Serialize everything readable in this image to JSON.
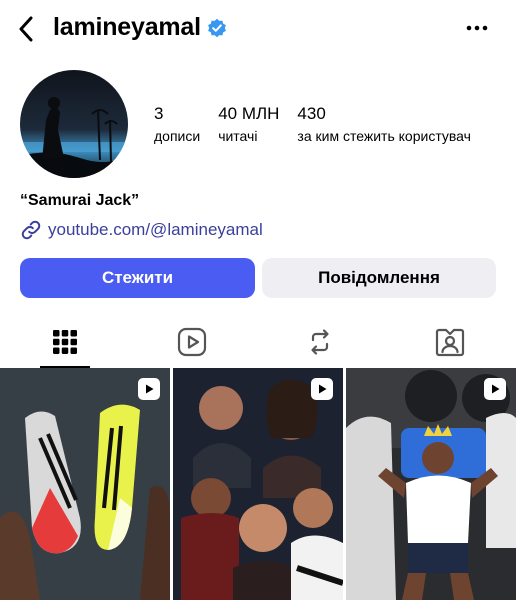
{
  "header": {
    "username": "lamineyamal"
  },
  "profile": {
    "stats": [
      {
        "value": "3",
        "label": "дописи"
      },
      {
        "value": "40 МЛН",
        "label": "читачі"
      },
      {
        "value": "430",
        "label": "за ким стежить користувач"
      }
    ],
    "bio": "“Samurai Jack”",
    "link": "youtube.com/@lamineyamal"
  },
  "actions": {
    "follow_label": "Стежити",
    "message_label": "Повідомлення"
  },
  "tabs": [
    "grid",
    "reels",
    "reposts",
    "tagged"
  ],
  "posts": [
    {
      "type": "reel",
      "icon": "reel-icon"
    },
    {
      "type": "reel",
      "icon": "reel-icon"
    },
    {
      "type": "reel",
      "icon": "reel-icon"
    }
  ],
  "colors": {
    "accent": "#4a5cf2",
    "link": "#3a3f9c",
    "verified": "#3897f0",
    "secondary_button": "#efeff3"
  }
}
